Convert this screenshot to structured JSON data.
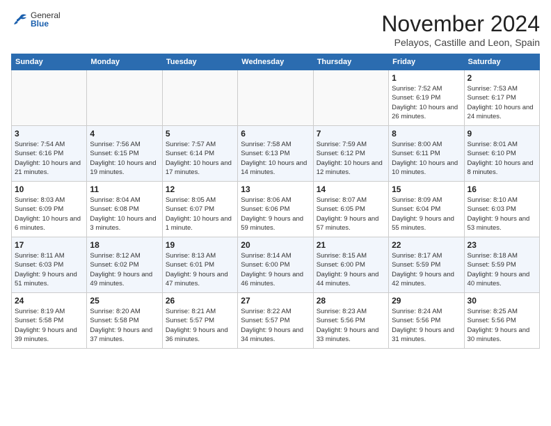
{
  "logo": {
    "text_general": "General",
    "text_blue": "Blue"
  },
  "title": "November 2024",
  "subtitle": "Pelayos, Castille and Leon, Spain",
  "header_days": [
    "Sunday",
    "Monday",
    "Tuesday",
    "Wednesday",
    "Thursday",
    "Friday",
    "Saturday"
  ],
  "weeks": [
    [
      {
        "day": "",
        "info": ""
      },
      {
        "day": "",
        "info": ""
      },
      {
        "day": "",
        "info": ""
      },
      {
        "day": "",
        "info": ""
      },
      {
        "day": "",
        "info": ""
      },
      {
        "day": "1",
        "info": "Sunrise: 7:52 AM\nSunset: 6:19 PM\nDaylight: 10 hours and 26 minutes."
      },
      {
        "day": "2",
        "info": "Sunrise: 7:53 AM\nSunset: 6:17 PM\nDaylight: 10 hours and 24 minutes."
      }
    ],
    [
      {
        "day": "3",
        "info": "Sunrise: 7:54 AM\nSunset: 6:16 PM\nDaylight: 10 hours and 21 minutes."
      },
      {
        "day": "4",
        "info": "Sunrise: 7:56 AM\nSunset: 6:15 PM\nDaylight: 10 hours and 19 minutes."
      },
      {
        "day": "5",
        "info": "Sunrise: 7:57 AM\nSunset: 6:14 PM\nDaylight: 10 hours and 17 minutes."
      },
      {
        "day": "6",
        "info": "Sunrise: 7:58 AM\nSunset: 6:13 PM\nDaylight: 10 hours and 14 minutes."
      },
      {
        "day": "7",
        "info": "Sunrise: 7:59 AM\nSunset: 6:12 PM\nDaylight: 10 hours and 12 minutes."
      },
      {
        "day": "8",
        "info": "Sunrise: 8:00 AM\nSunset: 6:11 PM\nDaylight: 10 hours and 10 minutes."
      },
      {
        "day": "9",
        "info": "Sunrise: 8:01 AM\nSunset: 6:10 PM\nDaylight: 10 hours and 8 minutes."
      }
    ],
    [
      {
        "day": "10",
        "info": "Sunrise: 8:03 AM\nSunset: 6:09 PM\nDaylight: 10 hours and 6 minutes."
      },
      {
        "day": "11",
        "info": "Sunrise: 8:04 AM\nSunset: 6:08 PM\nDaylight: 10 hours and 3 minutes."
      },
      {
        "day": "12",
        "info": "Sunrise: 8:05 AM\nSunset: 6:07 PM\nDaylight: 10 hours and 1 minute."
      },
      {
        "day": "13",
        "info": "Sunrise: 8:06 AM\nSunset: 6:06 PM\nDaylight: 9 hours and 59 minutes."
      },
      {
        "day": "14",
        "info": "Sunrise: 8:07 AM\nSunset: 6:05 PM\nDaylight: 9 hours and 57 minutes."
      },
      {
        "day": "15",
        "info": "Sunrise: 8:09 AM\nSunset: 6:04 PM\nDaylight: 9 hours and 55 minutes."
      },
      {
        "day": "16",
        "info": "Sunrise: 8:10 AM\nSunset: 6:03 PM\nDaylight: 9 hours and 53 minutes."
      }
    ],
    [
      {
        "day": "17",
        "info": "Sunrise: 8:11 AM\nSunset: 6:03 PM\nDaylight: 9 hours and 51 minutes."
      },
      {
        "day": "18",
        "info": "Sunrise: 8:12 AM\nSunset: 6:02 PM\nDaylight: 9 hours and 49 minutes."
      },
      {
        "day": "19",
        "info": "Sunrise: 8:13 AM\nSunset: 6:01 PM\nDaylight: 9 hours and 47 minutes."
      },
      {
        "day": "20",
        "info": "Sunrise: 8:14 AM\nSunset: 6:00 PM\nDaylight: 9 hours and 46 minutes."
      },
      {
        "day": "21",
        "info": "Sunrise: 8:15 AM\nSunset: 6:00 PM\nDaylight: 9 hours and 44 minutes."
      },
      {
        "day": "22",
        "info": "Sunrise: 8:17 AM\nSunset: 5:59 PM\nDaylight: 9 hours and 42 minutes."
      },
      {
        "day": "23",
        "info": "Sunrise: 8:18 AM\nSunset: 5:59 PM\nDaylight: 9 hours and 40 minutes."
      }
    ],
    [
      {
        "day": "24",
        "info": "Sunrise: 8:19 AM\nSunset: 5:58 PM\nDaylight: 9 hours and 39 minutes."
      },
      {
        "day": "25",
        "info": "Sunrise: 8:20 AM\nSunset: 5:58 PM\nDaylight: 9 hours and 37 minutes."
      },
      {
        "day": "26",
        "info": "Sunrise: 8:21 AM\nSunset: 5:57 PM\nDaylight: 9 hours and 36 minutes."
      },
      {
        "day": "27",
        "info": "Sunrise: 8:22 AM\nSunset: 5:57 PM\nDaylight: 9 hours and 34 minutes."
      },
      {
        "day": "28",
        "info": "Sunrise: 8:23 AM\nSunset: 5:56 PM\nDaylight: 9 hours and 33 minutes."
      },
      {
        "day": "29",
        "info": "Sunrise: 8:24 AM\nSunset: 5:56 PM\nDaylight: 9 hours and 31 minutes."
      },
      {
        "day": "30",
        "info": "Sunrise: 8:25 AM\nSunset: 5:56 PM\nDaylight: 9 hours and 30 minutes."
      }
    ]
  ]
}
